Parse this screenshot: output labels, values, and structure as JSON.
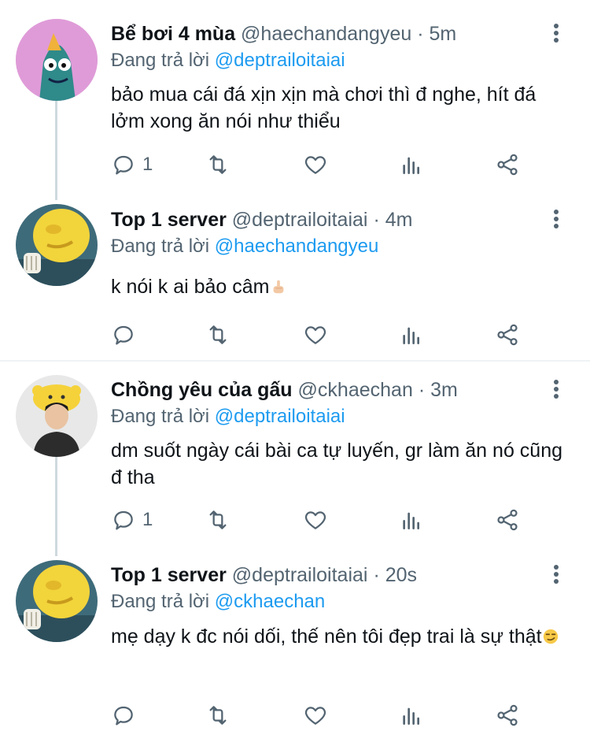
{
  "replying_to_label": "Đang trả lời",
  "tweets": [
    {
      "name": "Bể bơi 4 mùa",
      "handle": "@haechandangyeu",
      "dot": "·",
      "time": "5m",
      "reply_to": "@deptrailoitaiai",
      "text": "bảo mua cái đá xịn xịn mà chơi thì đ nghe, hít đá lởm xong ăn nói như thiểu",
      "reply_count": "1",
      "colors": {
        "avatar_bg": "#d98fd0",
        "avatar_fg": "#2f8a8a"
      }
    },
    {
      "name": "Top 1 server",
      "handle": "@deptrailoitaiai",
      "dot": "·",
      "time": "4m",
      "reply_to": "@haechandangyeu",
      "text": "k nói k ai bảo câm",
      "emoji": "raised-finger-emoji",
      "reply_count": "",
      "colors": {
        "avatar_bg": "#3e6b7a",
        "avatar_fg": "#f2d43b"
      }
    },
    {
      "name": "Chồng yêu của gấu",
      "handle": "@ckhaechan",
      "dot": "·",
      "time": "3m",
      "reply_to": "@deptrailoitaiai",
      "text": "dm suốt ngày cái bài ca tự luyến, gr làm ăn nó cũng đ tha",
      "reply_count": "1",
      "colors": {
        "avatar_bg": "#e8e8e8",
        "avatar_fg": "#f5d23a"
      }
    },
    {
      "name": "Top 1 server",
      "handle": "@deptrailoitaiai",
      "dot": "·",
      "time": "20s",
      "reply_to": "@ckhaechan",
      "text": "mẹ dạy k đc nói dối, thế nên tôi đẹp trai là sự thật",
      "emoji": "smirk-emoji",
      "reply_count": "",
      "colors": {
        "avatar_bg": "#3e6b7a",
        "avatar_fg": "#f2d43b"
      }
    }
  ],
  "colors": {
    "accent": "#1d9bf0",
    "muted": "#536471",
    "thread_line": "#cfd9de"
  }
}
